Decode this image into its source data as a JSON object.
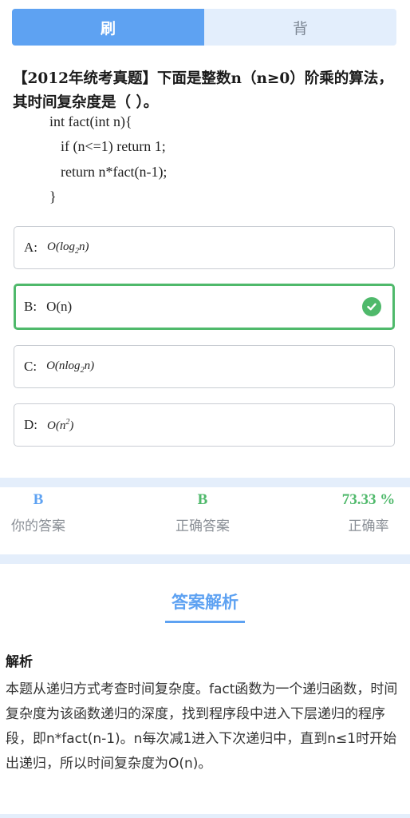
{
  "tabs": {
    "brush": "刷",
    "recite": "背"
  },
  "question": {
    "text": "【2012年统考真题】下面是整数n（n≥0）阶乘的算法，其时间复杂度是（ ）。",
    "code": [
      "int fact(int n){",
      "if (n<=1) return 1;",
      "return n*fact(n-1);",
      "}"
    ]
  },
  "options": [
    {
      "letter": "A:",
      "math_pre": "O(log",
      "math_sub": "2",
      "math_post": "n)"
    },
    {
      "letter": "B:",
      "text": "O(n)",
      "correct": true
    },
    {
      "letter": "C:",
      "math_pre": "O(nlog",
      "math_sub": "2",
      "math_post": "n)"
    },
    {
      "letter": "D:",
      "math_pre": "O(n",
      "math_sup": "2",
      "math_post": ")"
    }
  ],
  "stats": {
    "your_answer": {
      "value": "B",
      "label": "你的答案"
    },
    "correct_answer": {
      "value": "B",
      "label": "正确答案"
    },
    "accuracy": {
      "value": "73.33 %",
      "label": "正确率"
    }
  },
  "analysis": {
    "title": "答案解析",
    "section_label": "解析",
    "body": "本题从递归方式考查时间复杂度。fact函数为一个递归函数，时间复杂度为该函数递归的深度，找到程序段中进入下层递归的程序段，即n*fact(n-1)。n每次减1进入下次递归中，直到n≤1时开始出递归，所以时间复杂度为O(n)。"
  },
  "colors": {
    "accent": "#5ea2f2",
    "correct": "#4fb96b",
    "band": "#e4eefb"
  },
  "icons": {
    "correct": "check-circle-icon"
  }
}
